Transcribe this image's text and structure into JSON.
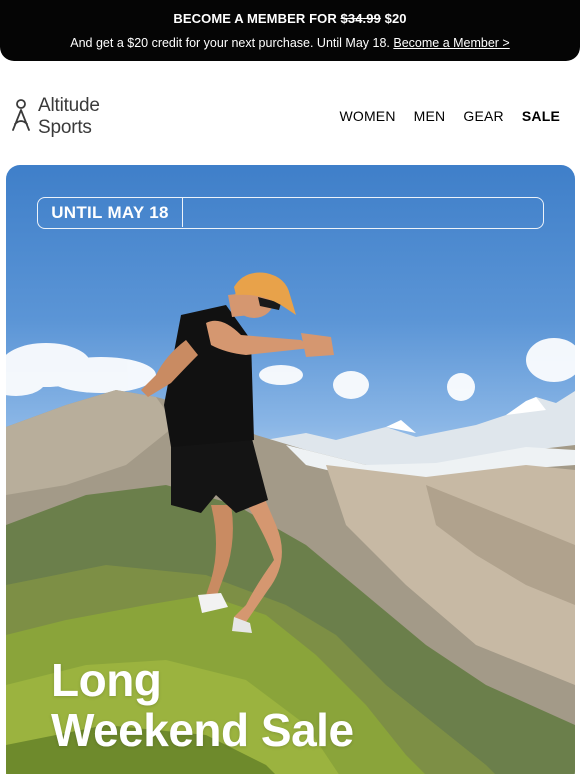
{
  "banner": {
    "title_prefix": "BECOME A MEMBER FOR",
    "old_price": "$34.99",
    "new_price": "$20",
    "subtitle": "And get a $20 credit for your next purchase. Until May 18.",
    "cta_link": "Become a Member >"
  },
  "logo": {
    "line1": "Altitude",
    "line2": "Sports",
    "icon": "person-logo-icon"
  },
  "nav": {
    "items": [
      {
        "label": "WOMEN"
      },
      {
        "label": "MEN"
      },
      {
        "label": "GEAR"
      },
      {
        "label": "SALE"
      }
    ]
  },
  "hero": {
    "countdown_label": "UNTIL MAY 18",
    "headline_line1": "Long",
    "headline_line2": "Weekend Sale",
    "image": "trail-runner-on-mountain-image"
  }
}
